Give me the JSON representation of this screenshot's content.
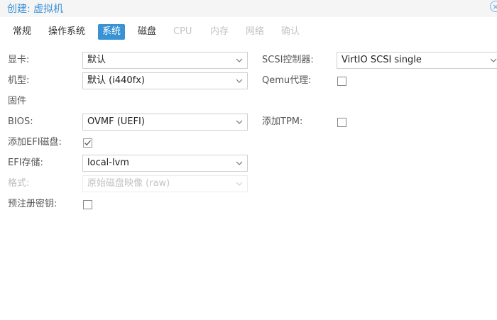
{
  "title": "创建: 虚拟机",
  "tabs": [
    {
      "label": "常规",
      "state": "enabled"
    },
    {
      "label": "操作系统",
      "state": "enabled"
    },
    {
      "label": "系统",
      "state": "active"
    },
    {
      "label": "磁盘",
      "state": "enabled"
    },
    {
      "label": "CPU",
      "state": "disabled"
    },
    {
      "label": "内存",
      "state": "disabled"
    },
    {
      "label": "网络",
      "state": "disabled"
    },
    {
      "label": "确认",
      "state": "disabled"
    }
  ],
  "left": {
    "graphics_label": "显卡:",
    "graphics_value": "默认",
    "machine_label": "机型:",
    "machine_value": "默认 (i440fx)",
    "firmware_section": "固件",
    "bios_label": "BIOS:",
    "bios_value": "OVMF (UEFI)",
    "add_efi_label": "添加EFI磁盘:",
    "add_efi_checked": true,
    "efi_storage_label": "EFI存储:",
    "efi_storage_value": "local-lvm",
    "format_label": "格式:",
    "format_value": "原始磁盘映像 (raw)",
    "pre_enroll_label": "预注册密钥:",
    "pre_enroll_checked": false
  },
  "right": {
    "scsi_label": "SCSI控制器:",
    "scsi_value": "VirtIO SCSI single",
    "qemu_agent_label": "Qemu代理:",
    "qemu_agent_checked": false,
    "tpm_label": "添加TPM:",
    "tpm_checked": false
  },
  "colors": {
    "accent": "#3892d4",
    "title": "#3a8fd8",
    "disabled_text": "#c4c4c4"
  },
  "icons": {
    "dropdown": "chevron-down-icon",
    "checkmark": "checkmark-icon",
    "close": "close-icon"
  }
}
